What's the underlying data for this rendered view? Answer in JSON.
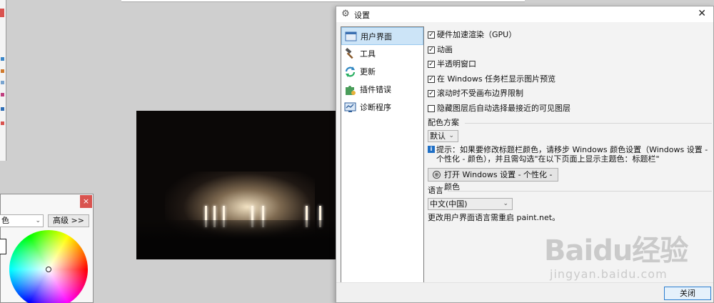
{
  "colors_window": {
    "mode_value": "色",
    "advanced_label": "高级 >>",
    "close_label": "×"
  },
  "dialog": {
    "title": "设置",
    "close_x": "✕",
    "nav": [
      {
        "label": "用户界面",
        "icon": "monitor-icon"
      },
      {
        "label": "工具",
        "icon": "hammer-icon"
      },
      {
        "label": "更新",
        "icon": "refresh-icon"
      },
      {
        "label": "插件错误",
        "icon": "puzzle-icon"
      },
      {
        "label": "诊断程序",
        "icon": "diagnostics-icon"
      }
    ],
    "options": [
      {
        "label": "硬件加速渲染（GPU）",
        "checked": true
      },
      {
        "label": "动画",
        "checked": true
      },
      {
        "label": "半透明窗口",
        "checked": true
      },
      {
        "label": "在 Windows 任务栏显示图片预览",
        "checked": true
      },
      {
        "label": "滚动时不受画布边界限制",
        "checked": true
      },
      {
        "label": "隐藏图层后自动选择最接近的可见图层",
        "checked": false
      }
    ],
    "color_scheme": {
      "heading": "配色方案",
      "value": "默认",
      "tip": "提示：如果要修改标题栏颜色，请移步 Windows 颜色设置（Windows 设置 - 个性化 - 颜色），并且需勾选\"在以下页面上显示主题色：标题栏\"",
      "open_button": "打开 Windows 设置 - 个性化 - 颜色"
    },
    "language": {
      "heading": "语言",
      "value": "中文(中国)",
      "note": "更改用户界面语言需重启 paint.net。"
    },
    "close_button": "关闭"
  },
  "watermark": {
    "logo": "Baidu经验",
    "url": "jingyan.baidu.com"
  },
  "colors": {
    "accent": "#cce4f7",
    "close_red": "#d9534f",
    "info_blue": "#1f6fc5"
  }
}
